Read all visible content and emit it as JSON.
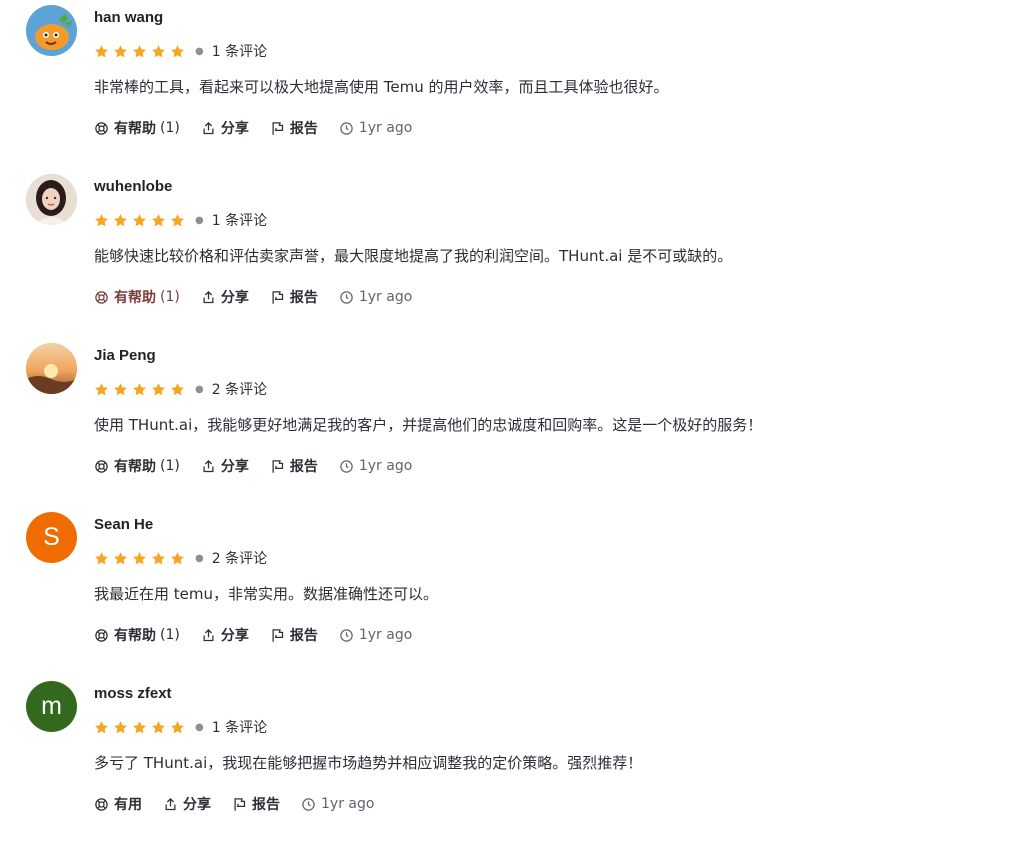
{
  "reviews": [
    {
      "name": "han wang",
      "avatar": {
        "type": "image",
        "icon": "carrot-cartoon-avatar",
        "bg": "#f1c96b"
      },
      "stars": 5,
      "review_count": "1 条评论",
      "text": "非常棒的工具，看起来可以极大地提高使用 Temu 的用户效率，而且工具体验也很好。",
      "helpful_label": "有帮助",
      "helpful_count": "(1)",
      "share_label": "分享",
      "report_label": "报告",
      "time": "1yr ago"
    },
    {
      "name": "wuhenlobe",
      "avatar": {
        "type": "image",
        "icon": "woman-portrait-avatar",
        "bg": "#d9c7b8"
      },
      "stars": 5,
      "review_count": "1 条评论",
      "text": "能够快速比较价格和评估卖家声誉，最大限度地提高了我的利润空间。THunt.ai 是不可或缺的。",
      "helpful_label": "有帮助",
      "helpful_count": "(1)",
      "helpful_active": true,
      "share_label": "分享",
      "report_label": "报告",
      "time": "1yr ago"
    },
    {
      "name": "Jia Peng",
      "avatar": {
        "type": "image",
        "icon": "sunset-landscape-avatar",
        "bg": "#e7a35a"
      },
      "stars": 5,
      "review_count": "2 条评论",
      "text": "使用 THunt.ai，我能够更好地满足我的客户，并提高他们的忠诚度和回购率。这是一个极好的服务！",
      "helpful_label": "有帮助",
      "helpful_count": "(1)",
      "share_label": "分享",
      "report_label": "报告",
      "time": "1yr ago"
    },
    {
      "name": "Sean He",
      "avatar": {
        "type": "letter",
        "letter": "S",
        "bg": "#ef6c00"
      },
      "stars": 5,
      "review_count": "2 条评论",
      "text": "我最近在用 temu，非常实用。数据准确性还可以。",
      "helpful_label": "有帮助",
      "helpful_count": "(1)",
      "share_label": "分享",
      "report_label": "报告",
      "time": "1yr ago"
    },
    {
      "name": "moss zfext",
      "avatar": {
        "type": "letter",
        "letter": "m",
        "bg": "#33691e"
      },
      "stars": 5,
      "review_count": "1 条评论",
      "text": "多亏了 THunt.ai，我现在能够把握市场趋势并相应调整我的定价策略。强烈推荐！",
      "helpful_label": "有用",
      "helpful_count": "",
      "share_label": "分享",
      "report_label": "报告",
      "time": "1yr ago"
    }
  ],
  "colors": {
    "star": "#f6a623",
    "active_helpful": "#7a3e3a"
  }
}
